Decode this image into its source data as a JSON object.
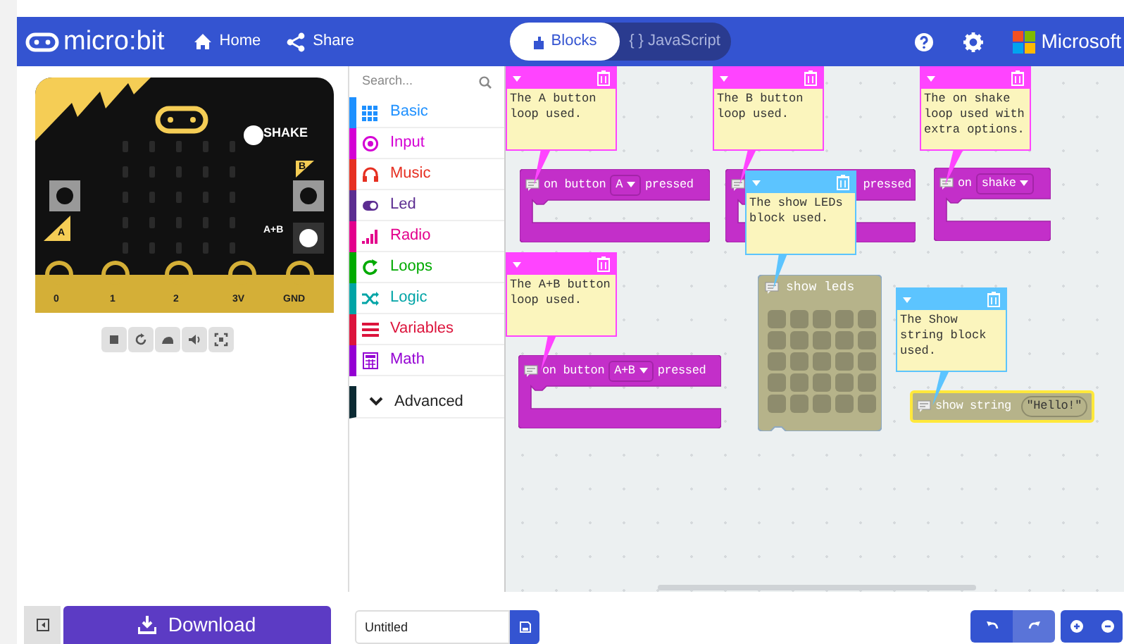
{
  "header": {
    "logo": "micro:bit",
    "nav": [
      {
        "label": "Home",
        "kind": "home"
      },
      {
        "label": "Share",
        "kind": "share"
      }
    ],
    "editor_tabs": [
      {
        "label": "Blocks",
        "selected": true
      },
      {
        "label": "{ } JavaScript",
        "selected": false
      }
    ],
    "brand": "Microsoft"
  },
  "simulator": {
    "shake_label": "SHAKE",
    "button_labels": [
      "A",
      "B",
      "A+B"
    ],
    "pins": [
      "0",
      "1",
      "2",
      "3V",
      "GND"
    ]
  },
  "toolbox": {
    "search": {
      "placeholder": "Search..."
    },
    "categories": [
      {
        "label": "Basic",
        "color": "#1e90ff",
        "kind": "grid"
      },
      {
        "label": "Input",
        "color": "#d400d4",
        "kind": "target"
      },
      {
        "label": "Music",
        "color": "#e63022",
        "kind": "headphones"
      },
      {
        "label": "Led",
        "color": "#5c2d91",
        "kind": "toggle"
      },
      {
        "label": "Radio",
        "color": "#e3008c",
        "kind": "signal"
      },
      {
        "label": "Loops",
        "color": "#00aa00",
        "kind": "loop"
      },
      {
        "label": "Logic",
        "color": "#00a4a6",
        "kind": "shuffle"
      },
      {
        "label": "Variables",
        "color": "#dc143c",
        "kind": "lines"
      },
      {
        "label": "Math",
        "color": "#9400d3",
        "kind": "calculator"
      }
    ],
    "advanced": "Advanced"
  },
  "workspace": {
    "comments": [
      {
        "text": "The A button loop used.",
        "color": "#ff44ff"
      },
      {
        "text": "The B button loop used.",
        "color": "#ff44ff"
      },
      {
        "text": "The on shake loop used with extra options.",
        "color": "#ff44ff"
      },
      {
        "text": "The A+B button loop used.",
        "color": "#ff44ff"
      },
      {
        "text": "The show LEDs block used.",
        "color": "#5cc4ff"
      },
      {
        "text": "The Show string block used.",
        "color": "#5cc4ff"
      }
    ],
    "blocks": [
      {
        "kind": "event",
        "parts": [
          {
            "kind": "text",
            "text": "on button"
          },
          {
            "kind": "dropdown",
            "text": "A"
          },
          {
            "kind": "text",
            "text": "pressed"
          }
        ]
      },
      {
        "kind": "event",
        "parts": [
          {
            "kind": "text",
            "text": "pressed"
          }
        ]
      },
      {
        "kind": "event",
        "parts": [
          {
            "kind": "text",
            "text": "on"
          },
          {
            "kind": "dropdown",
            "text": "shake"
          }
        ]
      },
      {
        "kind": "event",
        "parts": [
          {
            "kind": "text",
            "text": "on button"
          },
          {
            "kind": "dropdown",
            "text": "A+B"
          },
          {
            "kind": "text",
            "text": "pressed"
          }
        ]
      },
      {
        "kind": "leds",
        "label": "show leds"
      },
      {
        "kind": "string",
        "label": "show string",
        "value": "\"Hello!\""
      }
    ]
  },
  "footer": {
    "download": "Download",
    "project_name": "Untitled"
  }
}
